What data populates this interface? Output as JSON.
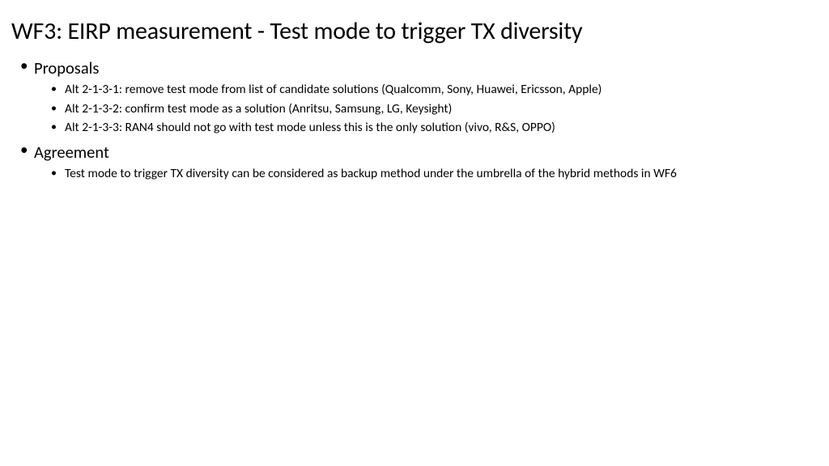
{
  "title": "WF3: EIRP measurement - Test mode to trigger TX diversity",
  "sections": [
    {
      "label": "Proposals",
      "items": [
        "Alt 2-1-3-1: remove test mode from list of candidate solutions (Qualcomm, Sony, Huawei, Ericsson, Apple)",
        "Alt 2-1-3-2: confirm test mode as a solution (Anritsu, Samsung, LG, Keysight)",
        "Alt 2-1-3-3: RAN4 should not go with test mode unless this is the only solution (vivo, R&S, OPPO)"
      ]
    },
    {
      "label": "Agreement",
      "items": [
        "Test mode to trigger TX diversity can be considered as backup method under the umbrella of the hybrid methods in WF6"
      ]
    }
  ]
}
